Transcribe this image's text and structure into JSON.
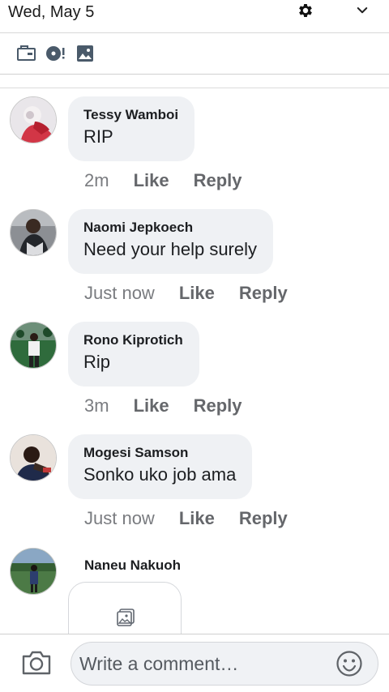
{
  "status_bar": {
    "date": "Wed, May 5",
    "icons": [
      "gear-icon",
      "chevron-down-icon"
    ]
  },
  "toolbar": {
    "icons": [
      "folder-card-icon",
      "record-alert-icon",
      "image-icon"
    ]
  },
  "comments": [
    {
      "author": "Tessy Wamboi",
      "text": "RIP",
      "time": "2m",
      "like_label": "Like",
      "reply_label": "Reply"
    },
    {
      "author": "Naomi Jepkoech",
      "text": "Need your help surely",
      "time": "Just now",
      "like_label": "Like",
      "reply_label": "Reply"
    },
    {
      "author": "Rono Kiprotich",
      "text": "Rip",
      "time": "3m",
      "like_label": "Like",
      "reply_label": "Reply"
    },
    {
      "author": "Mogesi Samson",
      "text": "Sonko uko job ama",
      "time": "Just now",
      "like_label": "Like",
      "reply_label": "Reply"
    }
  ],
  "last_comment": {
    "author": "Naneu Nakuoh",
    "attachment_icon": "image-placeholder-icon"
  },
  "composer": {
    "placeholder": "Write a comment…",
    "camera_icon": "camera-icon",
    "emoji_icon": "smiley-icon"
  },
  "colors": {
    "bubble": "#eff1f4",
    "action_text": "#65676b",
    "author_text": "#1c1e21"
  }
}
